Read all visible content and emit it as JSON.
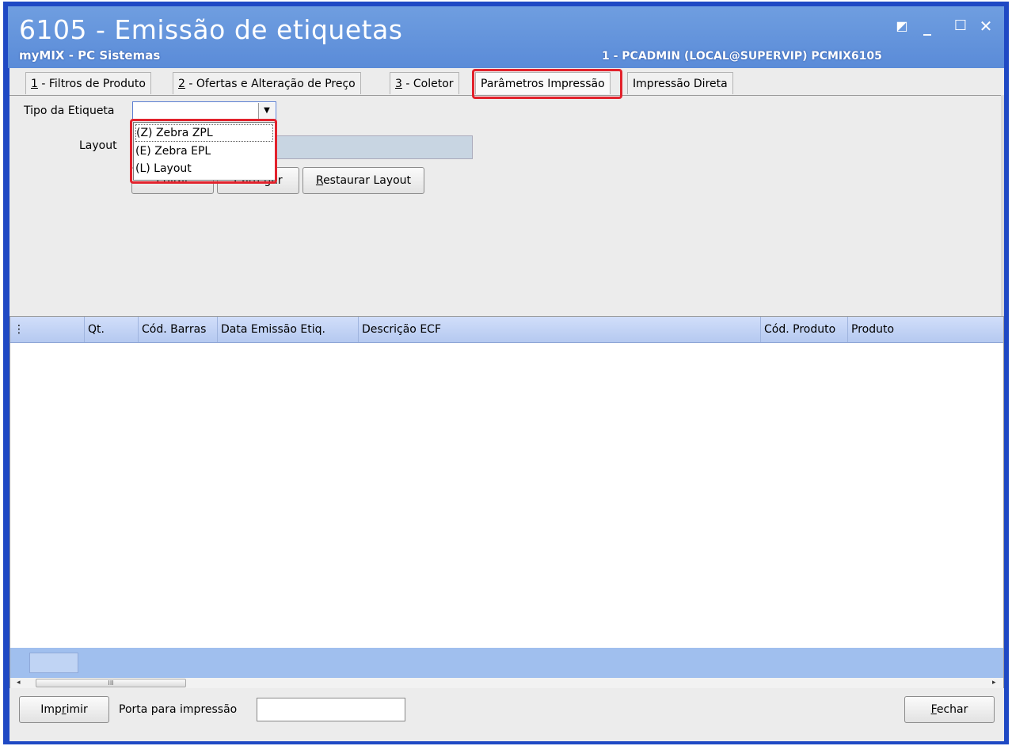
{
  "window": {
    "title": "6105 - Emissão de etiquetas",
    "subtitle": "myMIX - PC Sistemas",
    "user_info": "1 - PCADMIN (LOCAL@SUPERVIP)   PCMIX6105",
    "controls": {
      "restore": "◩",
      "minimize": "_",
      "maximize": "☐",
      "close": "✕"
    }
  },
  "tabs": [
    {
      "key": "1",
      "label": " - Filtros de Produto"
    },
    {
      "key": "2",
      "label": " - Ofertas e Alteração de Preço"
    },
    {
      "key": "3",
      "label": " - Coletor"
    },
    {
      "key": "",
      "label": "Parâmetros Impressão",
      "active": true
    },
    {
      "key": "",
      "label": "Impressão Direta"
    }
  ],
  "form": {
    "tipo_label": "Tipo da Etiqueta",
    "tipo_value": "",
    "layout_label": "Layout",
    "dropdown_options": [
      "(Z) Zebra ZPL",
      "(E) Zebra EPL",
      "(L) Layout"
    ],
    "buttons": {
      "hidden1": "Editar",
      "hidden2": "Carregar",
      "restaurar_key": "R",
      "restaurar_rest": "estaurar Layout"
    }
  },
  "grid": {
    "columns": [
      "",
      "Qt.",
      "Cód. Barras",
      "Data Emissão Etiq.",
      "Descrição ECF",
      "Cód. Produto",
      "Produto"
    ],
    "scroll_thumb": "III"
  },
  "bottom": {
    "imprimir_pre": "Imp",
    "imprimir_key": "r",
    "imprimir_post": "imir",
    "porta_label": "Porta para impressão",
    "porta_value": "",
    "fechar_key": "F",
    "fechar_rest": "echar"
  },
  "colors": {
    "highlight": "#e2222c",
    "titlebar": "#5a8bd8",
    "grid_header": "#b5c9f0"
  }
}
